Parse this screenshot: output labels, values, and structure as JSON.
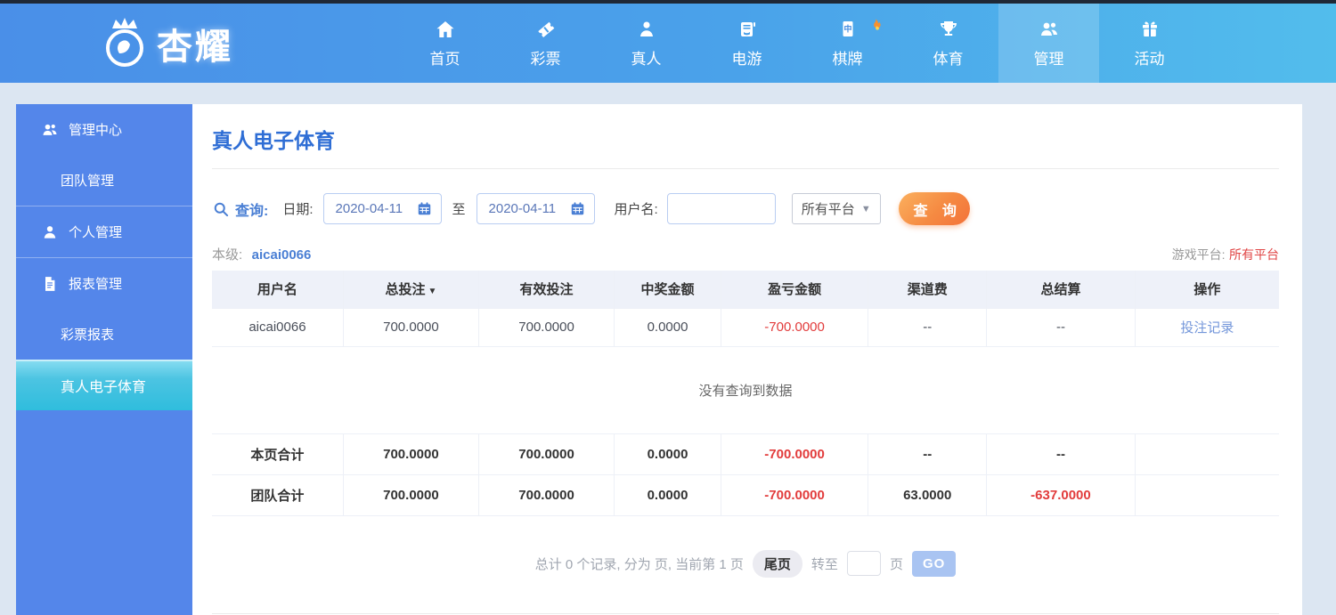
{
  "colors": {
    "nav_gradient_left": "#4a8fe8",
    "nav_gradient_right": "#52bdec",
    "sidebar_blue": "#5486ea",
    "active_cyan": "#2fbddd",
    "accent_blue": "#2f6ed5",
    "negative_red": "#e23c3c",
    "button_orange": "#f58a42",
    "platform_red": "#e04444"
  },
  "brand": {
    "logo_text": "杏耀",
    "logo_icon": "crown-badge-icon"
  },
  "nav": {
    "items": [
      {
        "label": "首页",
        "icon": "home-icon",
        "active": false
      },
      {
        "label": "彩票",
        "icon": "ticket-icon",
        "active": false
      },
      {
        "label": "真人",
        "icon": "person-icon",
        "active": false
      },
      {
        "label": "电游",
        "icon": "slot-machine-icon",
        "active": false
      },
      {
        "label": "棋牌",
        "icon": "mahjong-tile-icon",
        "hot_icon": "flame-icon",
        "active": false
      },
      {
        "label": "体育",
        "icon": "trophy-icon",
        "active": false
      },
      {
        "label": "管理",
        "icon": "users-icon",
        "active": true
      },
      {
        "label": "活动",
        "icon": "gift-icon",
        "active": false
      }
    ]
  },
  "sidebar": {
    "items": [
      {
        "label": "管理中心",
        "icon": "users-icon",
        "level": "parent",
        "active": false
      },
      {
        "label": "团队管理",
        "level": "child",
        "active": false
      },
      {
        "label": "个人管理",
        "icon": "user-icon",
        "level": "parent",
        "active": false
      },
      {
        "label": "报表管理",
        "icon": "document-icon",
        "level": "parent",
        "active": false
      },
      {
        "label": "彩票报表",
        "level": "child",
        "active": false
      },
      {
        "label": "真人电子体育",
        "level": "child",
        "active": true
      }
    ]
  },
  "main": {
    "title": "真人电子体育",
    "search": {
      "icon": "search-icon",
      "query_label": "查询:",
      "date_label": "日期:",
      "date_from": "2020-04-11",
      "to_label": "至",
      "date_to": "2020-04-11",
      "calendar_icon": "calendar-icon",
      "username_label": "用户名:",
      "username_value": "",
      "platform_selected": "所有平台",
      "select_arrow": "▼",
      "submit_label": "查 询"
    },
    "level": {
      "label": "本级:",
      "value": "aicai0066"
    },
    "platform_info": {
      "label": "游戏平台:",
      "value": "所有平台"
    },
    "table": {
      "headers": [
        "用户名",
        "总投注",
        "有效投注",
        "中奖金额",
        "盈亏金额",
        "渠道费",
        "总结算",
        "操作"
      ],
      "sort_column": "总投注",
      "sort_arrow": "▼",
      "row": [
        "aicai0066",
        "700.0000",
        "700.0000",
        "0.0000",
        "-700.0000",
        "--",
        "--"
      ],
      "row_action": "投注记录",
      "empty_message": "没有查询到数据",
      "page_total": [
        "本页合计",
        "700.0000",
        "700.0000",
        "0.0000",
        "-700.0000",
        "--",
        "--"
      ],
      "team_total": [
        "团队合计",
        "700.0000",
        "700.0000",
        "0.0000",
        "-700.0000",
        "63.0000",
        "-637.0000"
      ]
    },
    "pagination": {
      "summary": "总计 0 个记录, 分为 页, 当前第 1 页",
      "last_page_label": "尾页",
      "goto_label": "转至",
      "page_input_value": "",
      "page_unit_label": "页",
      "go_label": "GO"
    }
  }
}
